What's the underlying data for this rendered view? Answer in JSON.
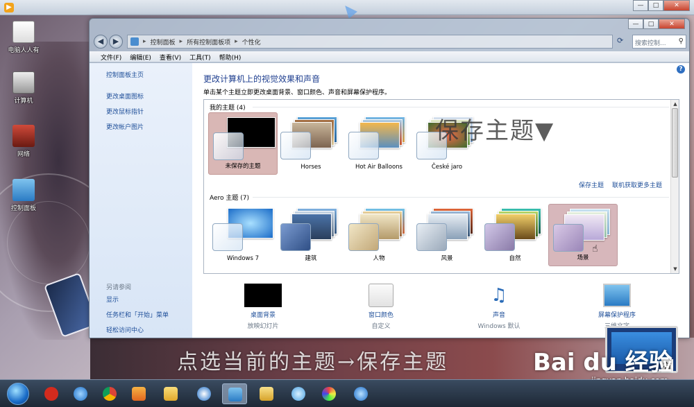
{
  "desktop": {
    "icons": [
      {
        "label": "电脑人人有"
      },
      {
        "label": "计算机"
      },
      {
        "label": "网络"
      },
      {
        "label": "控制面板"
      }
    ]
  },
  "window": {
    "address": {
      "crumbs": [
        "控制面板",
        "所有控制面板项",
        "个性化"
      ],
      "search_placeholder": "搜索控制..."
    },
    "menu": [
      "文件(F)",
      "编辑(E)",
      "查看(V)",
      "工具(T)",
      "帮助(H)"
    ],
    "sidebar": {
      "links": [
        "控制面板主页",
        "更改桌面图标",
        "更改鼠标指针",
        "更改帐户图片"
      ],
      "see_also_title": "另请参阅",
      "see_also": [
        "显示",
        "任务栏和「开始」菜单",
        "轻松访问中心"
      ]
    },
    "content": {
      "title": "更改计算机上的视觉效果和声音",
      "subtitle": "单击某个主题立即更改桌面背景、窗口颜色、声音和屏幕保护程序。",
      "my_themes": {
        "title": "我的主题 (4)",
        "items": [
          "未保存的主题",
          "Horses",
          "Hot Air Balloons",
          "České jaro"
        ]
      },
      "aero_themes": {
        "title": "Aero 主题 (7)",
        "items": [
          "Windows 7",
          "建筑",
          "人物",
          "风景",
          "自然",
          "场景"
        ]
      },
      "save_theme_link": "保存主题",
      "more_themes_link": "联机获取更多主题",
      "overlay_annotation": "保存主题▼",
      "bottom": [
        {
          "name": "桌面背景",
          "value": "放映幻灯片"
        },
        {
          "name": "窗口颜色",
          "value": "自定义"
        },
        {
          "name": "声音",
          "value": "Windows 默认"
        },
        {
          "name": "屏幕保护程序",
          "value": "三维文字"
        }
      ]
    }
  },
  "watermark": {
    "caption": "点选当前的主题→保存主题",
    "logo": "Bai du 经验",
    "url": "jingyan.baidu.com",
    "badge": "有"
  },
  "taskbar": {
    "pinned": [
      "start-orb",
      "jiang-app",
      "ie",
      "chrome",
      "media-player",
      "file-folder",
      "qq-browser",
      "control-panel",
      "explorer",
      "network",
      "paint",
      "bluetooth"
    ]
  },
  "colors": {
    "link": "#1f4f99",
    "title_blue": "#1e3e8f",
    "selected_theme": "#d9b7b5"
  }
}
